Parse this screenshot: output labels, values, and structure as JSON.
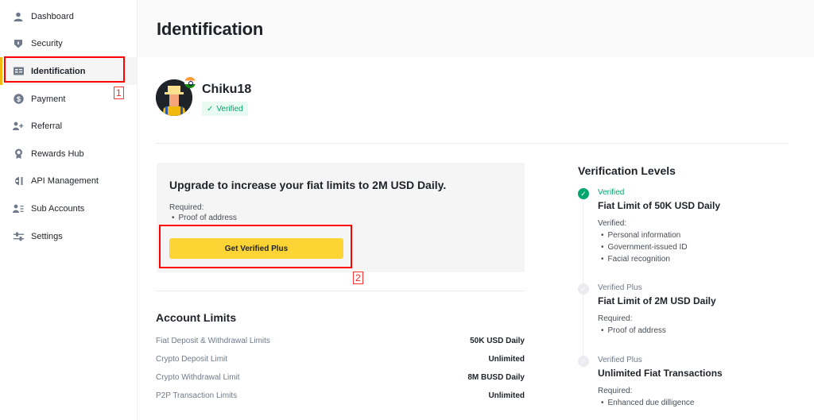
{
  "sidebar": {
    "items": [
      {
        "label": "Dashboard",
        "icon": "user-icon",
        "active": false
      },
      {
        "label": "Security",
        "icon": "shield-icon",
        "active": false
      },
      {
        "label": "Identification",
        "icon": "id-card-icon",
        "active": true
      },
      {
        "label": "Payment",
        "icon": "dollar-icon",
        "active": false
      },
      {
        "label": "Referral",
        "icon": "add-user-icon",
        "active": false
      },
      {
        "label": "Rewards Hub",
        "icon": "medal-icon",
        "active": false
      },
      {
        "label": "API Management",
        "icon": "api-icon",
        "active": false
      },
      {
        "label": "Sub Accounts",
        "icon": "sub-accounts-icon",
        "active": false
      },
      {
        "label": "Settings",
        "icon": "sliders-icon",
        "active": false
      }
    ]
  },
  "annotations": {
    "one": "1",
    "two": "2"
  },
  "header": {
    "title": "Identification"
  },
  "profile": {
    "username": "Chiku18",
    "badge": "Verified",
    "badge_check": "✓",
    "country_flag": "India"
  },
  "upgrade": {
    "title": "Upgrade to increase your fiat limits to 2M USD Daily.",
    "required_label": "Required:",
    "requirements": [
      "Proof of address"
    ],
    "cta_label": "Get Verified Plus"
  },
  "account_limits": {
    "title": "Account Limits",
    "rows": [
      {
        "label": "Fiat Deposit & Withdrawal Limits",
        "value": "50K USD Daily"
      },
      {
        "label": "Crypto Deposit Limit",
        "value": "Unlimited"
      },
      {
        "label": "Crypto Withdrawal Limit",
        "value": "8M BUSD Daily"
      },
      {
        "label": "P2P Transaction Limits",
        "value": "Unlimited"
      }
    ]
  },
  "verification_levels": {
    "title": "Verification Levels",
    "levels": [
      {
        "status": "Verified",
        "title": "Fiat Limit of 50K USD Daily",
        "req_label": "Verified:",
        "items": [
          "Personal information",
          "Government-issued ID",
          "Facial recognition"
        ],
        "done": true
      },
      {
        "status": "Verified Plus",
        "title": "Fiat Limit of 2M USD Daily",
        "req_label": "Required:",
        "items": [
          "Proof of address"
        ],
        "done": false
      },
      {
        "status": "Verified Plus",
        "title": "Unlimited Fiat Transactions",
        "req_label": "Required:",
        "items": [
          "Enhanced due dilligence"
        ],
        "done": false
      }
    ]
  },
  "colors": {
    "accent": "#fcd535",
    "success": "#03a66d",
    "annotation": "#ff0000"
  }
}
